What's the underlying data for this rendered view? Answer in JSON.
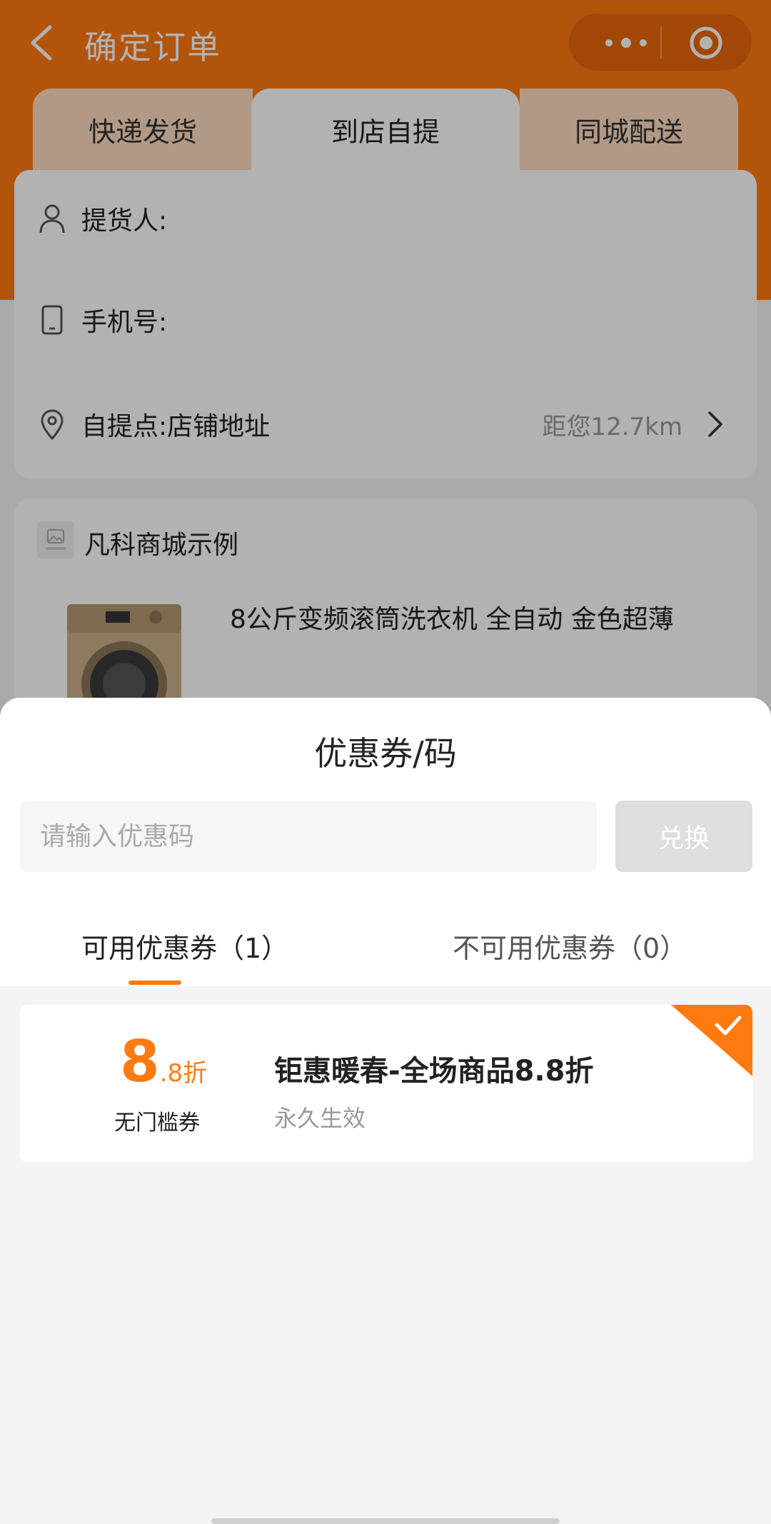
{
  "header": {
    "title": "确定订单",
    "back_icon": "chevron-left-icon",
    "more_icon": "more-dots-icon",
    "close_icon": "target-circle-icon"
  },
  "delivery_tabs": [
    {
      "label": "快递发货",
      "active": false
    },
    {
      "label": "到店自提",
      "active": true
    },
    {
      "label": "同城配送",
      "active": false
    }
  ],
  "pickup": {
    "contact_label": "提货人:",
    "phone_label": "手机号:",
    "pickup_point_label": "自提点:",
    "pickup_point_value": "店铺地址",
    "distance": "距您12.7km"
  },
  "shop": {
    "name": "凡科商城示例",
    "product_name": "8公斤变频滚筒洗衣机 全自动 金色超薄"
  },
  "coupon_sheet": {
    "title": "优惠券/码",
    "code_placeholder": "请输入优惠码",
    "redeem_label": "兑换",
    "tab_available": "可用优惠券（1）",
    "tab_unavailable": "不可用优惠券（0）",
    "coupon": {
      "discount_main": "8",
      "discount_suffix": ".8折",
      "type": "无门槛券",
      "name": "钜惠暖春-全场商品8.8折",
      "validity": "永久生效",
      "selected": true
    }
  },
  "colors": {
    "brand": "#ff7a10",
    "tab_inactive": "#ffdcbf",
    "redeem_disabled": "#dedede"
  }
}
